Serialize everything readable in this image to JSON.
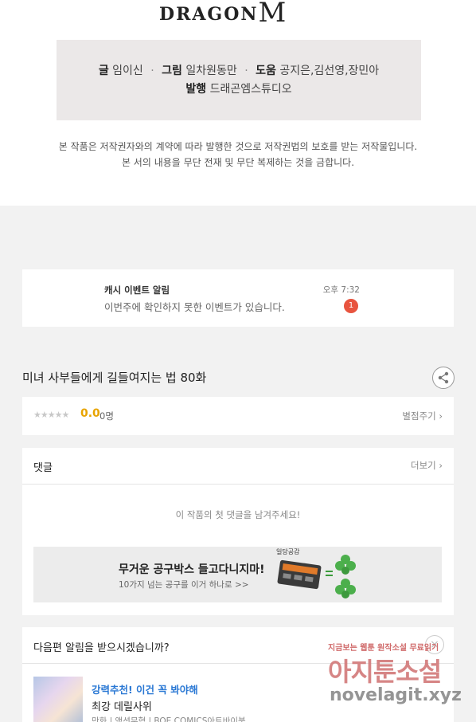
{
  "logo": {
    "text": "DRAGON",
    "mark": "M"
  },
  "credits": {
    "line1": [
      {
        "label": "글",
        "value": "임이신"
      },
      {
        "label": "그림",
        "value": "일차원동만"
      },
      {
        "label": "도움",
        "value": "공지은,김선영,장민아"
      }
    ],
    "line2": {
      "label": "발행",
      "value": "드래곤엠스튜디오"
    },
    "separator": "·"
  },
  "copyright": {
    "line1": "본 작품은 저작권자와의 계약에 따라 발행한 것으로 저작권법의 보호를 받는 저작물입니다.",
    "line2": "본 서의 내용을 무단 전재 및 무단 복제하는 것을 금합니다."
  },
  "notification": {
    "title": "캐시 이벤트 알림",
    "message": "이번주에 확인하지 못한 이벤트가 있습니다.",
    "time": "오후 7:32",
    "badge": "1"
  },
  "episode": {
    "title": "미녀 사부들에게 길들여지는 법 80화"
  },
  "rating": {
    "stars": "★★★★★",
    "score": "0.0",
    "count": "0명",
    "rate_button": "별점주기 ›"
  },
  "comments": {
    "header": "댓글",
    "more": "더보기 ›",
    "empty_message": "이 작품의 첫 댓글을 남겨주세요!"
  },
  "ad": {
    "title": "무거운 공구박스 들고다니지마!",
    "subtitle": "10가지 넘는 공구를 이거 하나로 >>",
    "image_label": "일당공감"
  },
  "next_episode": {
    "question": "다음편 알림을 받으시겠습니까?",
    "close": "×",
    "recommend": "강력추천! 이건 꼭 봐야해",
    "name": "최강 데릴사위",
    "meta": "만화 | 액션무협 | BOE COMICS아트바이북"
  },
  "watermark": {
    "line1": "지금보는 웹툰 원작소설 무료읽기",
    "line2": "아지툰소설",
    "line3": "novelagit.xyz"
  },
  "colors": {
    "badge": "#e8543f",
    "score": "#e8a400",
    "link": "#2a78d4"
  }
}
